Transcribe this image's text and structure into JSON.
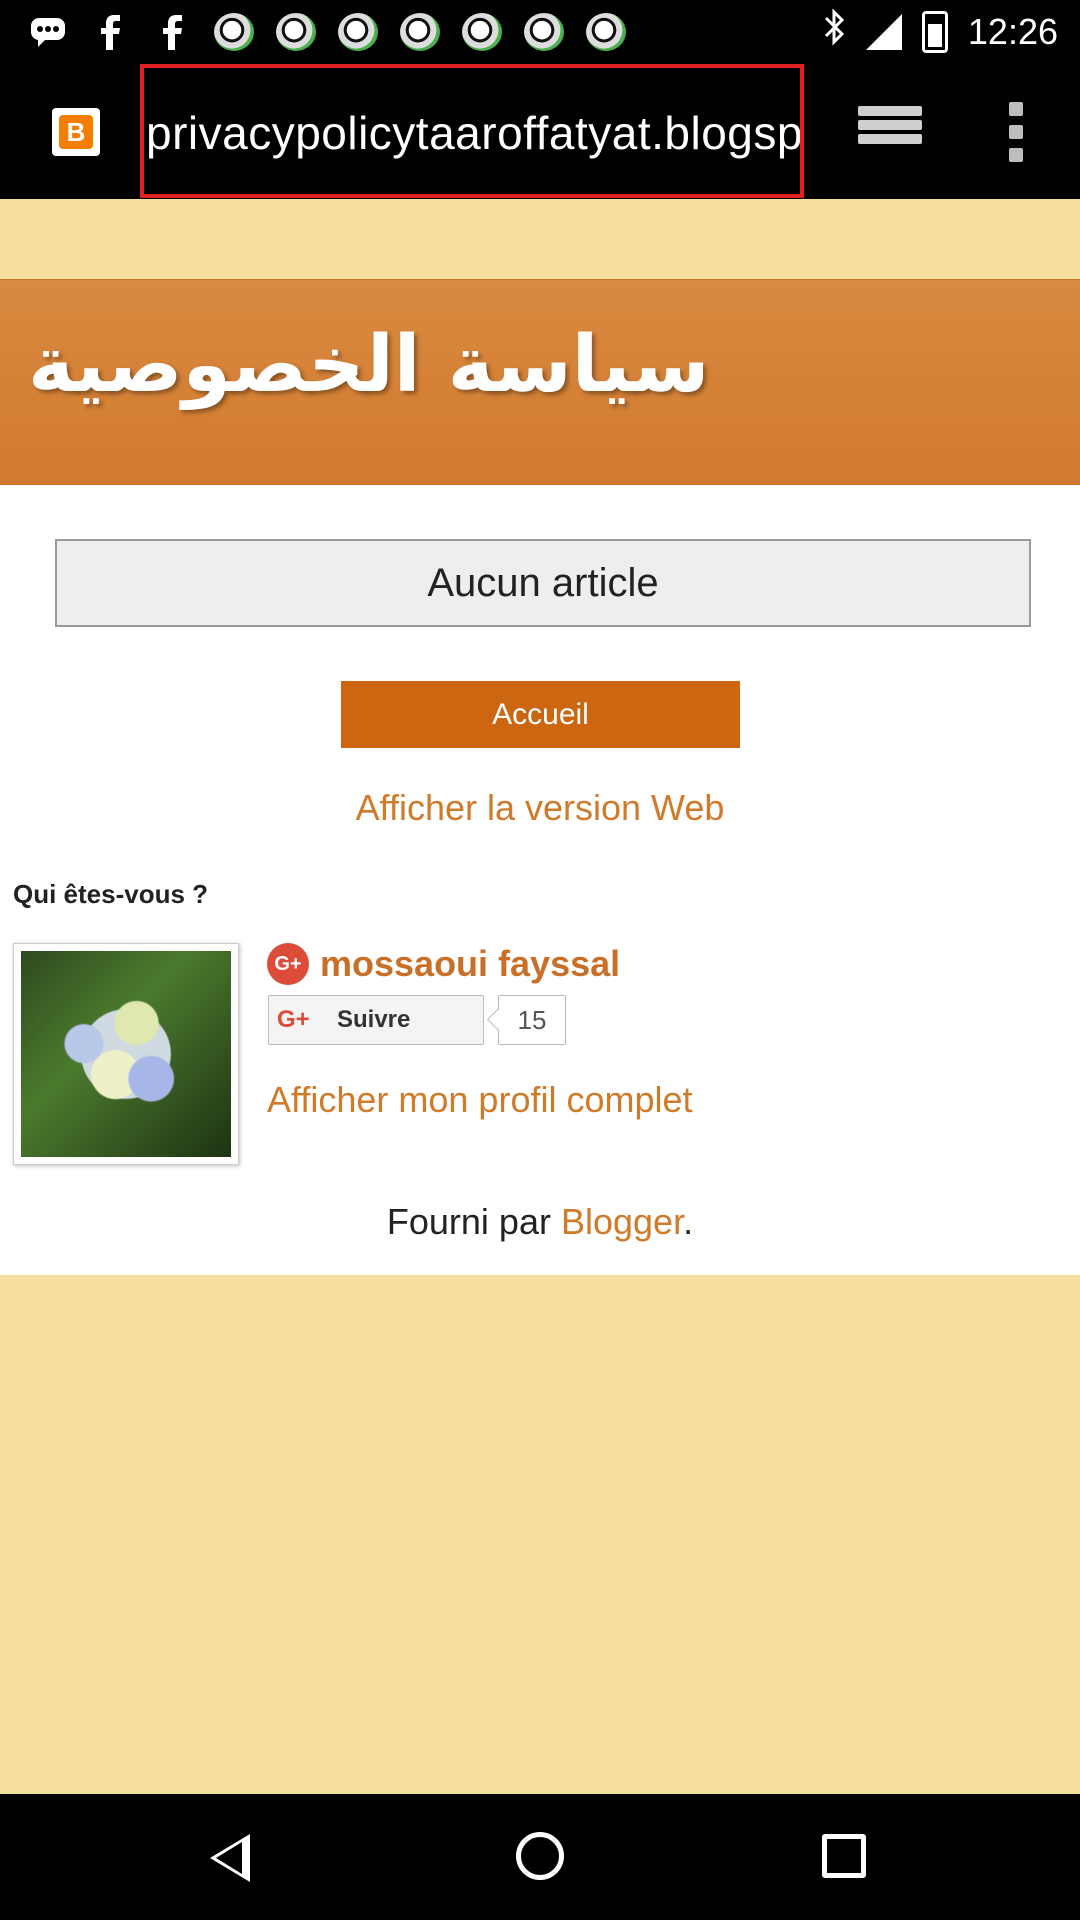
{
  "status_bar": {
    "time": "12:26",
    "icons": [
      "message-icon",
      "facebook-icon",
      "facebook-icon",
      "soccer-ball-icon",
      "soccer-ball-icon",
      "soccer-ball-icon",
      "soccer-ball-icon",
      "soccer-ball-icon",
      "soccer-ball-icon",
      "soccer-ball-icon",
      "bluetooth-icon",
      "signal-icon",
      "battery-icon"
    ]
  },
  "browser": {
    "url": "privacypolicytaaroffatyat.blogsp",
    "site_icon_letter": "B"
  },
  "blog": {
    "title": "سياسة الخصوصية",
    "no_article": "Aucun article",
    "home_button": "Accueil",
    "web_version_link": "Afficher la version Web",
    "who_heading": "Qui êtes-vous ?",
    "profile": {
      "gplus_label": "G+",
      "name": "mossaoui fayssal",
      "follow_g": "G+",
      "follow_label": "Suivre",
      "follow_count": "15",
      "full_profile_link": "Afficher mon profil complet"
    },
    "powered_prefix": "Fourni par ",
    "powered_brand": "Blogger",
    "powered_suffix": "."
  },
  "colors": {
    "accent": "#cc6611",
    "link": "#d07a2a",
    "page_background": "#f5de9e",
    "header_banner": "#d17a2f",
    "url_highlight_border": "#e02020"
  }
}
